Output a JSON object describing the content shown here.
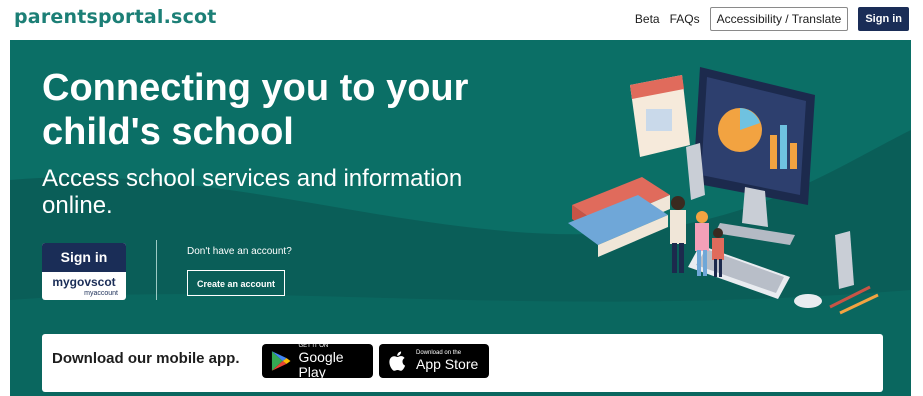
{
  "header": {
    "logo": "parentsportal.scot",
    "nav": {
      "beta": "Beta",
      "faqs": "FAQs",
      "accessibility": "Accessibility / Translate",
      "signin": "Sign in"
    }
  },
  "hero": {
    "headline": "Connecting you to your child's school",
    "subline": "Access school services and information online.",
    "signin_label": "Sign in",
    "mygov_brand": "mygovscot",
    "mygov_sub": "myaccount",
    "no_account": "Don't have an account?",
    "create_account": "Create an account"
  },
  "app": {
    "label": "Download our mobile app.",
    "google": {
      "small": "GET IT ON",
      "big": "Google Play"
    },
    "apple": {
      "small": "Download on the",
      "big": "App Store"
    }
  },
  "colors": {
    "teal": "#0b6f66",
    "teal_dark": "#0a5e58",
    "navy": "#1a2d57",
    "logo": "#1c7f76"
  },
  "icons": [
    "google-play-icon",
    "apple-icon"
  ]
}
